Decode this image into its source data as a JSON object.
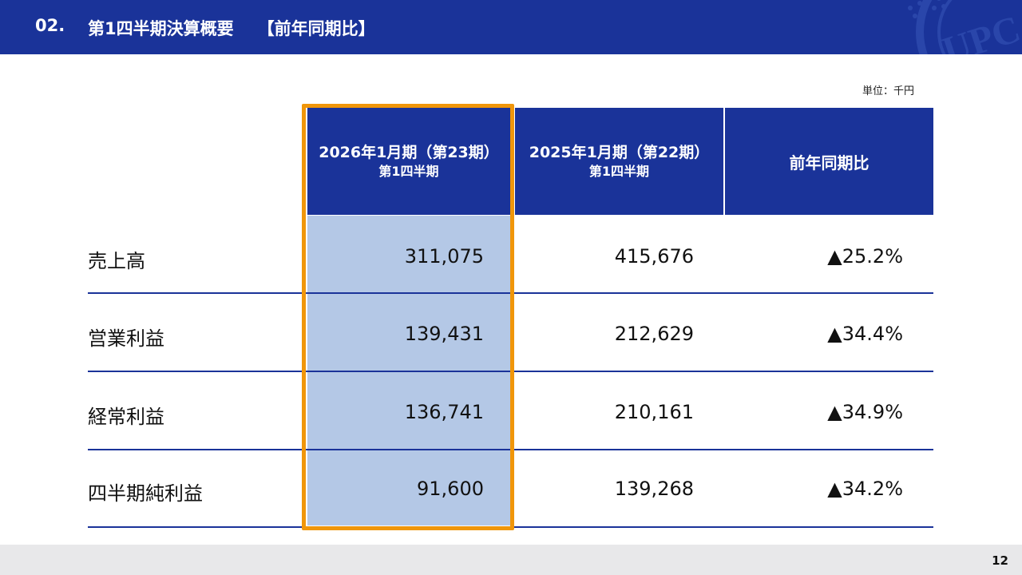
{
  "header": {
    "number": "02.",
    "title": "第1四半期決算概要",
    "subtitle": "【前年同期比】",
    "watermark_text": "UPC"
  },
  "unit_label": "単位：千円",
  "table": {
    "columns": [
      {
        "line1": "2026年1月期（第23期）",
        "line2": "第1四半期"
      },
      {
        "line1": "2025年1月期（第22期）",
        "line2": "第1四半期"
      },
      {
        "line1": "前年同期比"
      }
    ],
    "rows": [
      {
        "label": "売上高",
        "current": "311,075",
        "previous": "415,676",
        "change": "▲25.2%"
      },
      {
        "label": "営業利益",
        "current": "139,431",
        "previous": "212,629",
        "change": "▲34.4%"
      },
      {
        "label": "経常利益",
        "current": "136,741",
        "previous": "210,161",
        "change": "▲34.9%"
      },
      {
        "label": "四半期純利益",
        "current": "91,600",
        "previous": "139,268",
        "change": "▲34.2%"
      }
    ]
  },
  "page_number": "12",
  "colors": {
    "brand_blue": "#1a3399",
    "highlight_orange": "#f0960a",
    "column_fill": "#b4c8e6",
    "footer_gray": "#e8e8ea"
  }
}
